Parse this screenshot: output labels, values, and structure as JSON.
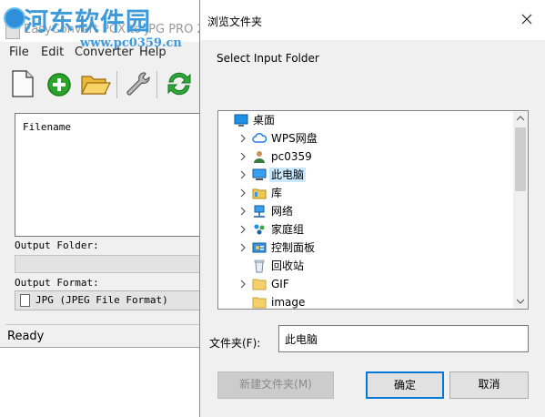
{
  "app": {
    "title": "EasyConvert PCX to JPG PRO 2",
    "watermark_title": "河东软件园",
    "watermark_url": "www.pc0359.cn",
    "menu": [
      "File",
      "Edit",
      "Converter",
      "Help"
    ],
    "toolbar": [
      {
        "name": "new-document-icon"
      },
      {
        "name": "add-icon"
      },
      {
        "name": "open-folder-icon"
      },
      {
        "name": "settings-wrench-icon"
      },
      {
        "name": "convert-refresh-icon"
      }
    ],
    "file_list_header": "Filename",
    "output_folder_label": "Output Folder:",
    "output_format_label": "Output Format:",
    "output_format_value": "JPG (JPEG File Format)",
    "status": "Ready"
  },
  "dialog": {
    "title": "浏览文件夹",
    "prompt": "Select Input Folder",
    "tree": [
      {
        "label": "桌面",
        "icon": "desktop-icon",
        "expander": false,
        "indent": 0,
        "selected": false
      },
      {
        "label": "WPS网盘",
        "icon": "cloud-icon",
        "expander": true,
        "indent": 1,
        "selected": false
      },
      {
        "label": "pc0359",
        "icon": "user-icon",
        "expander": true,
        "indent": 1,
        "selected": false
      },
      {
        "label": "此电脑",
        "icon": "computer-icon",
        "expander": true,
        "indent": 1,
        "selected": true
      },
      {
        "label": "库",
        "icon": "library-icon",
        "expander": true,
        "indent": 1,
        "selected": false
      },
      {
        "label": "网络",
        "icon": "network-icon",
        "expander": true,
        "indent": 1,
        "selected": false
      },
      {
        "label": "家庭组",
        "icon": "homegroup-icon",
        "expander": true,
        "indent": 1,
        "selected": false
      },
      {
        "label": "控制面板",
        "icon": "control-panel-icon",
        "expander": true,
        "indent": 1,
        "selected": false
      },
      {
        "label": "回收站",
        "icon": "recycle-bin-icon",
        "expander": false,
        "indent": 1,
        "selected": false
      },
      {
        "label": "GIF",
        "icon": "folder-icon",
        "expander": true,
        "indent": 1,
        "selected": false
      },
      {
        "label": "image",
        "icon": "folder-icon",
        "expander": false,
        "indent": 1,
        "selected": false
      }
    ],
    "folder_label": "文件夹(F):",
    "folder_value": "此电脑",
    "new_folder_button": "新建文件夹(M)",
    "ok_button": "确定",
    "cancel_button": "取消"
  },
  "colors": {
    "accent": "#0078d7",
    "selection": "#cce8ff",
    "watermark": "#3f9ad9"
  }
}
